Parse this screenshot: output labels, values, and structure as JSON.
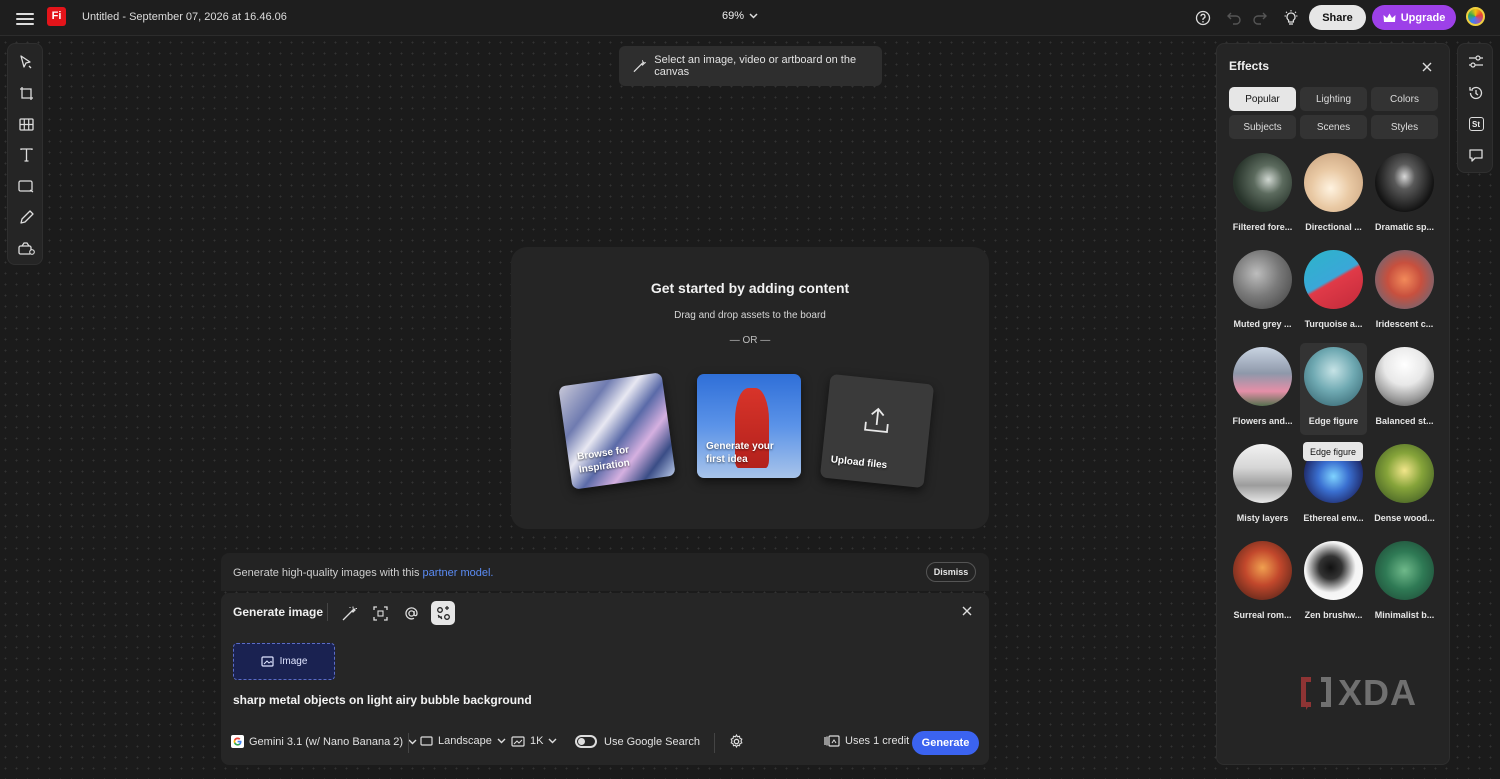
{
  "topbar": {
    "app_logo": "Fi",
    "doc_title": "Untitled - September 07, 2026 at 16.46.06",
    "zoom": "69%",
    "share_label": "Share",
    "upgrade_label": "Upgrade"
  },
  "hint": {
    "text": "Select an image, video or artboard on the canvas"
  },
  "start": {
    "title": "Get started by adding content",
    "subtitle": "Drag and drop assets to the board",
    "or": "— OR —",
    "cards": [
      {
        "label": "Browse for Inspiration"
      },
      {
        "label": "Generate your first idea"
      },
      {
        "label": "Upload files"
      }
    ]
  },
  "partner": {
    "text": "Generate high-quality images with this",
    "link": "partner model.",
    "dismiss": "Dismiss"
  },
  "generate": {
    "title": "Generate image",
    "image_chip": "Image",
    "prompt": "sharp metal objects on light airy bubble background",
    "model": "Gemini 3.1 (w/ Nano Banana 2)",
    "orientation": "Landscape",
    "resolution": "1K",
    "google_search_label": "Use Google Search",
    "credits": "Uses 1 credit",
    "generate_label": "Generate"
  },
  "effects": {
    "title": "Effects",
    "tabs": [
      "Popular",
      "Lighting",
      "Colors",
      "Subjects",
      "Scenes",
      "Styles"
    ],
    "active_tab": "Popular",
    "items": [
      {
        "label": "Filtered fore..."
      },
      {
        "label": "Directional ..."
      },
      {
        "label": "Dramatic sp..."
      },
      {
        "label": "Muted grey ..."
      },
      {
        "label": "Turquoise a..."
      },
      {
        "label": "Iridescent c..."
      },
      {
        "label": "Flowers and..."
      },
      {
        "label": "Edge figure"
      },
      {
        "label": "Balanced st..."
      },
      {
        "label": "Misty layers"
      },
      {
        "label": "Ethereal env..."
      },
      {
        "label": "Dense wood..."
      },
      {
        "label": "Surreal rom..."
      },
      {
        "label": "Zen brushw..."
      },
      {
        "label": "Minimalist b..."
      }
    ],
    "tooltip": "Edge figure"
  },
  "right_rail": {
    "stock_badge": "St"
  },
  "watermark": {
    "text": "XDA"
  },
  "colors": {
    "accent": "#3b63f0",
    "upgrade": "#9d40e8",
    "link": "#5b8cf5",
    "logo": "#e3141a"
  }
}
